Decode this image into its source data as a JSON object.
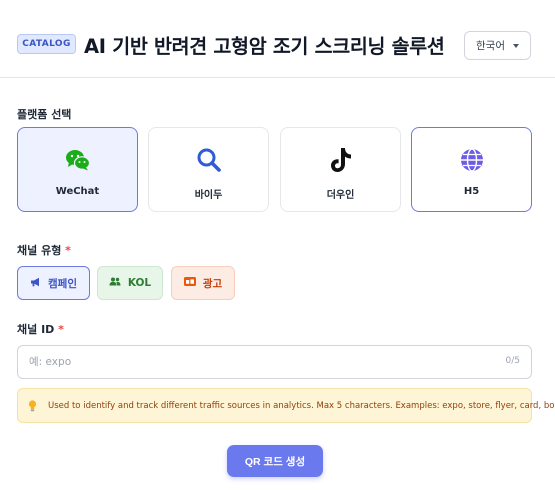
{
  "header": {
    "badge": "CATALOG",
    "title": "AI 기반 반려견 고형암 조기 스크리닝 솔루션",
    "language": {
      "selected": "한국어",
      "icon": "chevron-down-icon"
    }
  },
  "platform": {
    "label": "플랫폼 선택",
    "options": [
      {
        "label": "WeChat",
        "icon": "wechat-icon",
        "state": "selected",
        "color": "#1aad19"
      },
      {
        "label": "바이두",
        "icon": "search-icon",
        "state": "default",
        "color": "#2f5bd8"
      },
      {
        "label": "더우인",
        "icon": "tiktok-icon",
        "state": "default",
        "color": "#111111"
      },
      {
        "label": "H5",
        "icon": "globe-icon",
        "state": "outlined",
        "color": "#6c5ce7"
      }
    ]
  },
  "channel_type": {
    "label": "채널 유형",
    "required_mark": "*",
    "options": [
      {
        "label": "캠페인",
        "icon": "megaphone-icon",
        "state": "selected"
      },
      {
        "label": "KOL",
        "icon": "users-icon",
        "state": "default"
      },
      {
        "label": "광고",
        "icon": "ad-icon",
        "state": "default"
      }
    ]
  },
  "channel_id": {
    "label": "채널 ID",
    "required_mark": "*",
    "placeholder": "예: expo",
    "value": "",
    "counter": "0/5"
  },
  "hint": {
    "icon": "lightbulb-icon",
    "text": "Used to identify and track different traffic sources in analytics. Max 5 characters. Examples: expo, store, flyer, card, booth."
  },
  "actions": {
    "generate_label": "QR 코드 생성"
  },
  "colors": {
    "accent": "#6b79ee",
    "selected_border": "#6c7ae0",
    "selected_bg": "#eef1ff",
    "required": "#ef4444"
  }
}
